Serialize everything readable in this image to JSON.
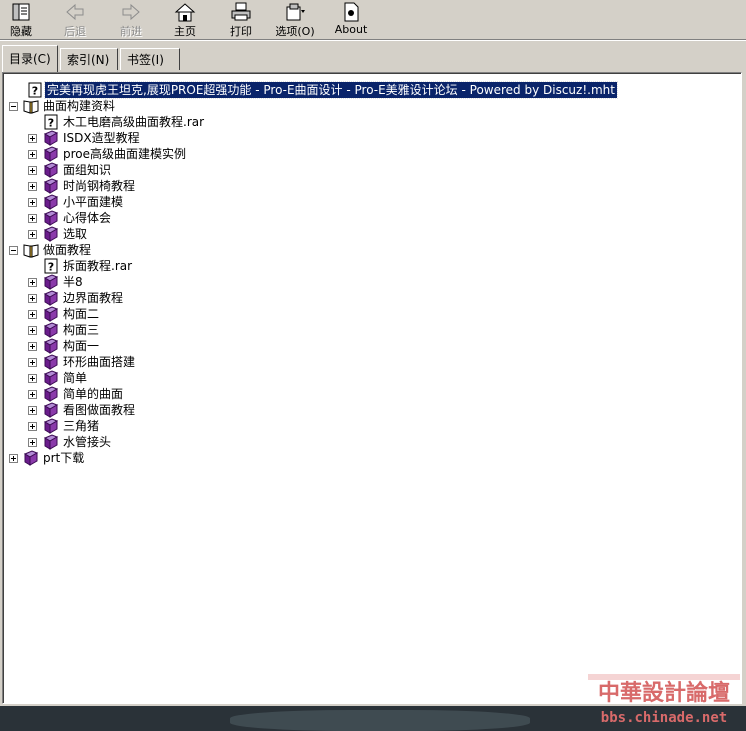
{
  "toolbar": {
    "hide_label": "隐藏",
    "back_label": "后退",
    "forward_label": "前进",
    "home_label": "主页",
    "print_label": "打印",
    "options_label": "选项(O)",
    "about_label": "About"
  },
  "tabs": {
    "contents": "目录(C)",
    "index": "索引(N)",
    "bookmarks": "书签(I)"
  },
  "tree": {
    "top_item": "完美再现虎王坦克,展现PROE超强功能 - Pro-E曲面设计 - Pro-E美雅设计论坛 - Powered by Discuz!.mht",
    "folder1": {
      "label": "曲面构建资料",
      "children": [
        "木工电磨高级曲面教程.rar",
        "ISDX造型教程",
        "proe高级曲面建模实例",
        "面组知识",
        "时尚钢椅教程",
        "小平面建模",
        "心得体会",
        "选取"
      ]
    },
    "folder2": {
      "label": "做面教程",
      "children": [
        "拆面教程.rar",
        "半8",
        "边界面教程",
        "构面二",
        "构面三",
        "构面一",
        "环形曲面搭建",
        "简单",
        "简单的曲面",
        "看图做面教程",
        "三角猪",
        "水管接头"
      ]
    },
    "folder3": {
      "label": "prt下载"
    }
  },
  "watermark": {
    "line1": "中華設計論壇",
    "line2": "bbs.chinade.net"
  }
}
